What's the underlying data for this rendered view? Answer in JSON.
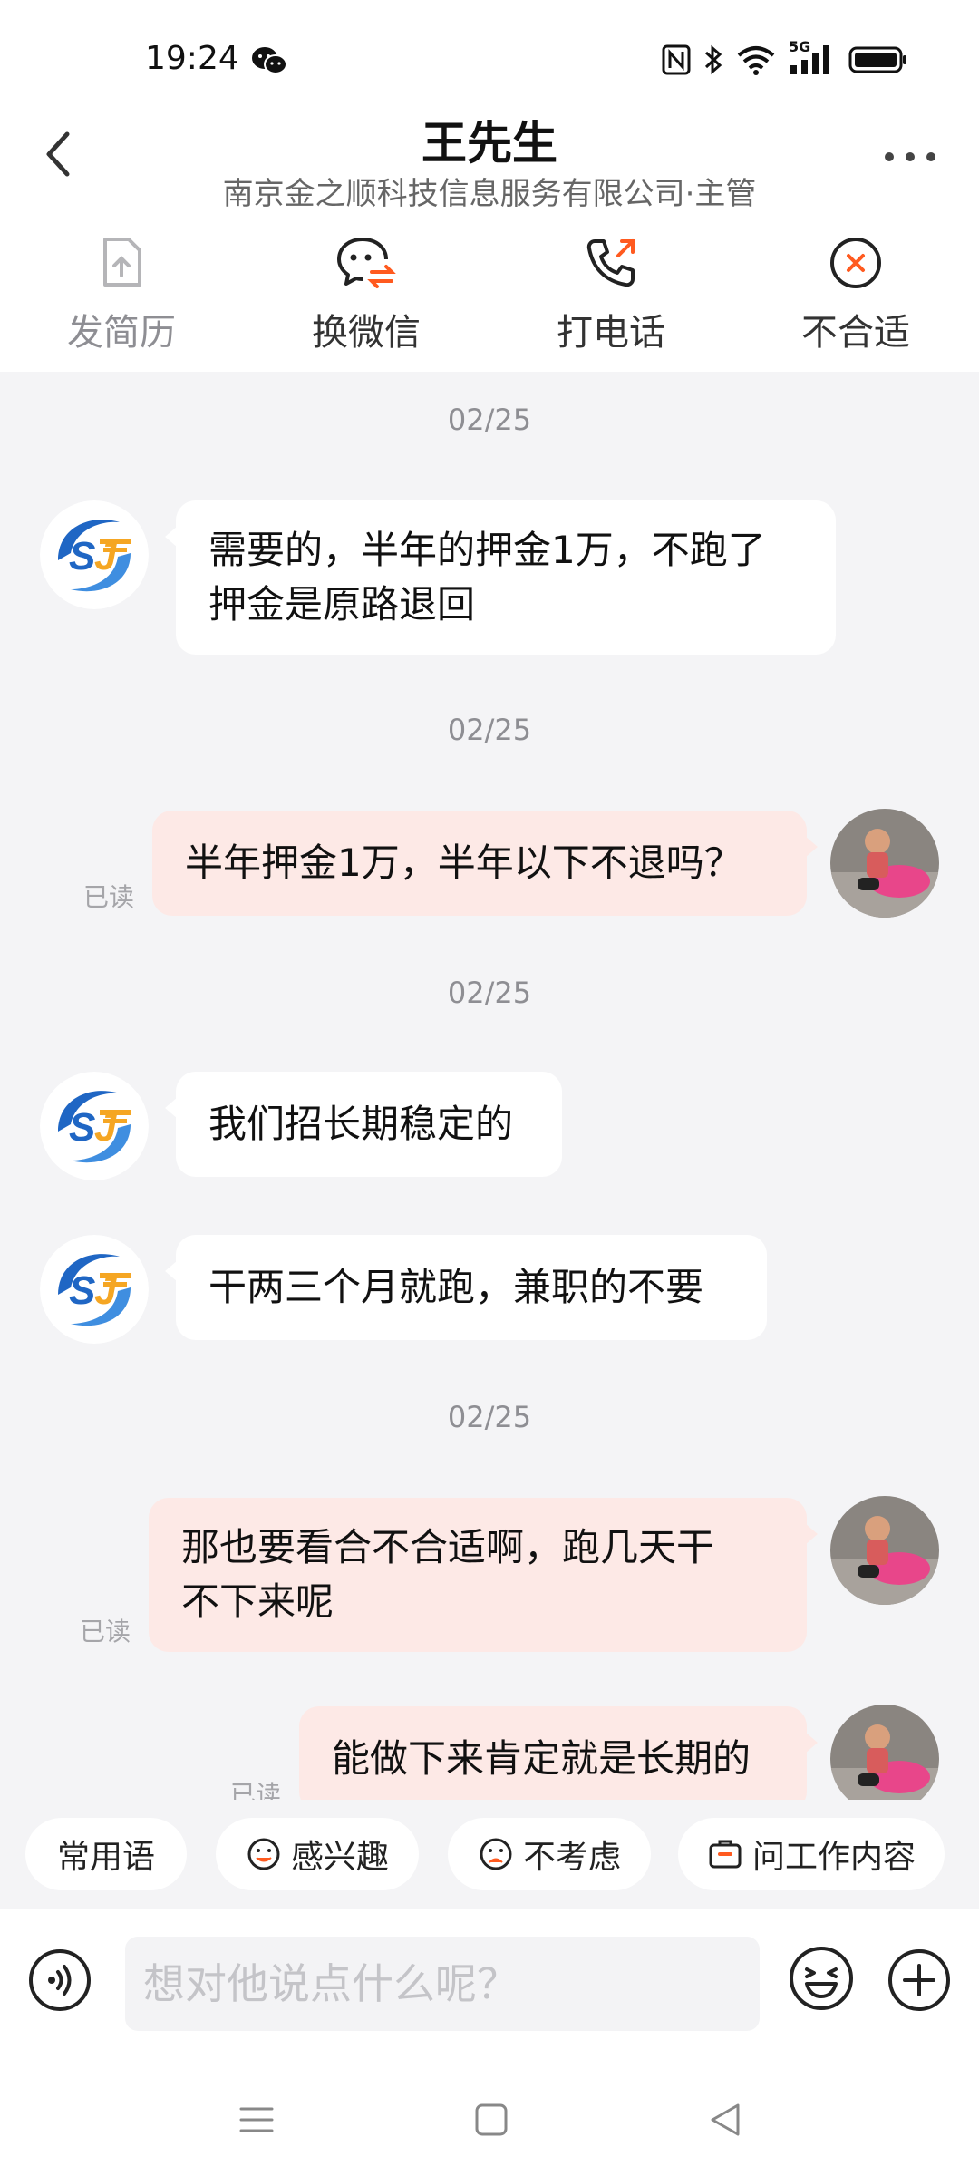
{
  "status_bar": {
    "time": "19:24",
    "icons": [
      "wechat-icon",
      "nfc-icon",
      "bluetooth-icon",
      "wifi-icon",
      "5g-signal-icon",
      "battery-icon"
    ],
    "network_label": "5G"
  },
  "header": {
    "title": "王先生",
    "subtitle": "南京金之顺科技信息服务有限公司·主管",
    "actions": [
      {
        "label": "发简历",
        "icon": "send-resume-icon",
        "color": "#b5b5b8"
      },
      {
        "label": "换微信",
        "icon": "wechat-swap-icon",
        "color": "#333333"
      },
      {
        "label": "打电话",
        "icon": "phone-call-icon",
        "color": "#333333"
      },
      {
        "label": "不合适",
        "icon": "not-suitable-icon",
        "color": "#333333"
      }
    ]
  },
  "messages": [
    {
      "date": "02/25",
      "side": "in",
      "lines": [
        "需要的，半年的押金1万，不跑了",
        "押金是原路退回"
      ]
    },
    {
      "date": "02/25",
      "side": "out",
      "lines": [
        "半年押金1万，半年以下不退吗？"
      ],
      "status": "已读"
    },
    {
      "date": "02/25",
      "side": "in",
      "lines": [
        "我们招长期稳定的"
      ]
    },
    {
      "side": "in",
      "lines": [
        "干两三个月就跑，兼职的不要"
      ]
    },
    {
      "date": "02/25",
      "side": "out",
      "lines": [
        "那也要看合不合适啊，跑几天干",
        "不下来呢"
      ],
      "status": "已读"
    },
    {
      "side": "out",
      "lines": [
        "能做下来肯定就是长期的"
      ],
      "status": "已读"
    }
  ],
  "quick_replies": [
    {
      "label": "常用语",
      "icon": ""
    },
    {
      "label": "感兴趣",
      "icon": "smile-icon"
    },
    {
      "label": "不考虑",
      "icon": "sad-icon"
    },
    {
      "label": "问工作内容",
      "icon": "briefcase-icon"
    }
  ],
  "input": {
    "placeholder": "想对他说点什么呢？",
    "value": ""
  },
  "colors": {
    "accent": "#ff5a1f",
    "outgoing_bubble": "#fde9e6",
    "incoming_bubble": "#ffffff",
    "background": "#f4f4f6"
  }
}
